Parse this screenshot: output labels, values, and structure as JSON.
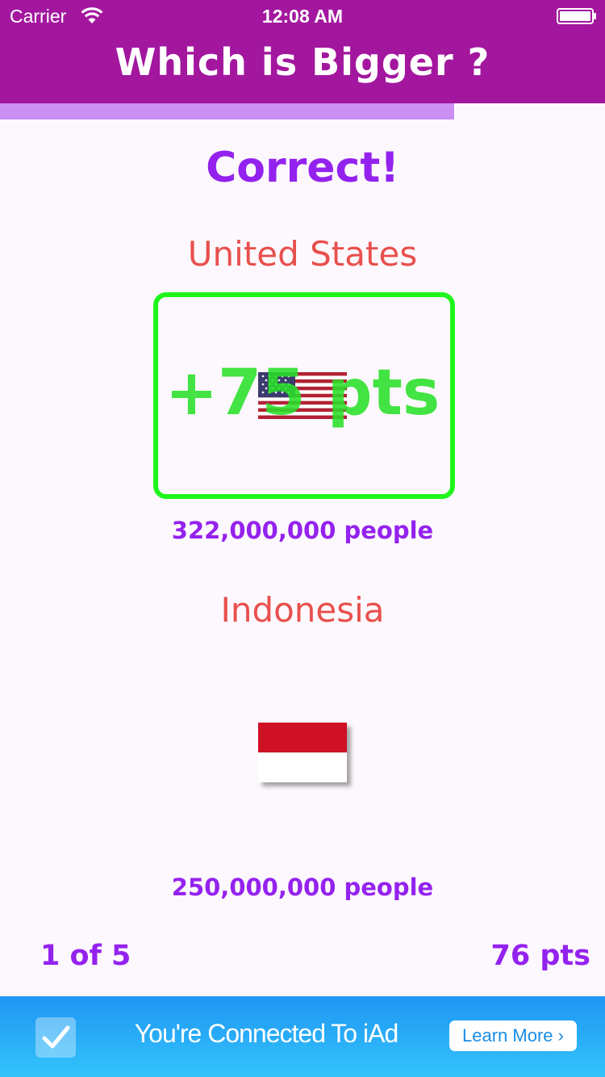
{
  "status_bar": {
    "carrier": "Carrier",
    "time": "12:08 AM"
  },
  "header": {
    "title": "Which is Bigger ?",
    "color": "#a3179f"
  },
  "progress": {
    "fraction": 0.75,
    "color": "#cc8ff3"
  },
  "result": {
    "text": "Correct!",
    "points_popup": "+75 pts"
  },
  "country_a": {
    "name": "United States",
    "population": "322,000,000 people",
    "flag": "us-flag-icon"
  },
  "country_b": {
    "name": "Indonesia",
    "population": "250,000,000 people",
    "flag": "indonesia-flag-icon"
  },
  "footer": {
    "question_counter": "1 of 5",
    "score": "76 pts"
  },
  "ad": {
    "text": "You're Connected To iAd",
    "button_label": "Learn More ›"
  },
  "colors": {
    "accent_purple": "#9422ef",
    "country_name_red": "#e8504d",
    "correct_green": "#1ff51d"
  }
}
